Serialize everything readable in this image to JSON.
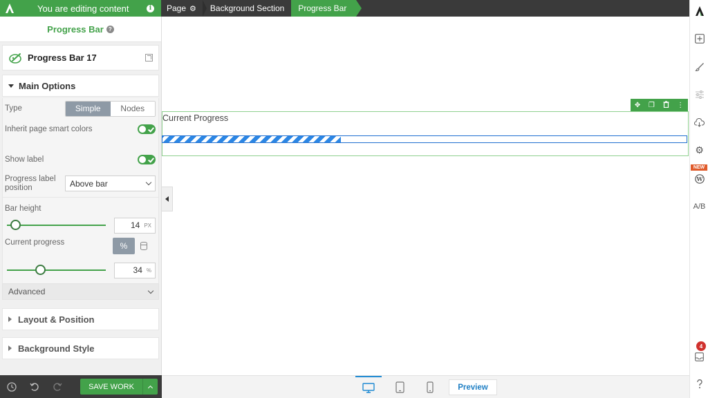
{
  "topbar": {
    "editing_text": "You are editing content",
    "crumbs": [
      "Page",
      "Background Section",
      "Progress Bar"
    ]
  },
  "panel": {
    "title": "Progress Bar",
    "element_name": "Progress Bar 17",
    "main_options_label": "Main Options",
    "type": {
      "label": "Type",
      "options": [
        "Simple",
        "Nodes"
      ],
      "selected": "Simple"
    },
    "inherit_colors": {
      "label": "Inherit page smart colors",
      "on": true
    },
    "show_label": {
      "label": "Show label",
      "on": true
    },
    "label_position": {
      "label": "Progress label position",
      "value": "Above bar"
    },
    "bar_height": {
      "label": "Bar height",
      "value": "14",
      "unit": "PX",
      "fraction": 0.09
    },
    "current_progress": {
      "label": "Current progress",
      "mode": "%",
      "value": "34",
      "unit": "%",
      "fraction": 0.34
    },
    "advanced_label": "Advanced",
    "layout_label": "Layout & Position",
    "background_label": "Background Style"
  },
  "bottombar": {
    "save_label": "SAVE WORK"
  },
  "canvas": {
    "progress_label": "Current Progress",
    "progress_value": 0.34,
    "bar_color": "#2b86e4"
  },
  "rail": {
    "new_badge": "NEW",
    "ab_label": "A/B",
    "notifications": "4"
  },
  "devicebar": {
    "preview_label": "Preview"
  },
  "colors": {
    "accent": "#43a24a",
    "topbar": "#3a3a3a",
    "link": "#1f7fc4"
  }
}
